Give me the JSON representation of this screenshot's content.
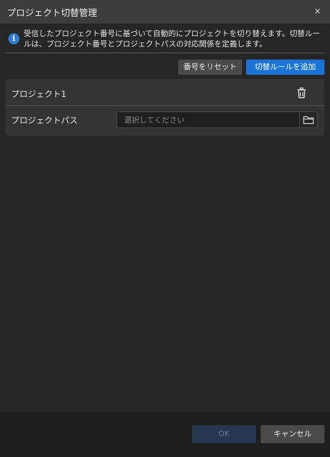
{
  "dialog": {
    "title": "プロジェクト切替管理",
    "close_glyph": "×"
  },
  "info": {
    "icon": "info-icon",
    "icon_glyph": "i",
    "text": "受信したプロジェクト番号に基づいて自動的にプロジェクトを切り替えます。切替ルールは、プロジェクト番号とプロジェクトパスの対応関係を定義します。"
  },
  "toolbar": {
    "reset_label": "番号をリセット",
    "add_rule_label": "切替ルールを追加"
  },
  "rules": [
    {
      "project_name": "プロジェクト1",
      "path_label": "プロジェクトパス",
      "path_value": "",
      "path_placeholder": "選択してください",
      "delete_icon": "trash-icon",
      "browse_icon": "folder-icon"
    }
  ],
  "footer": {
    "ok_label": "OK",
    "cancel_label": "キャンセル"
  },
  "colors": {
    "accent": "#1a73d9",
    "background": "#262626",
    "titlebar": "#3d3d3d",
    "disabled_button": "#26384f"
  }
}
